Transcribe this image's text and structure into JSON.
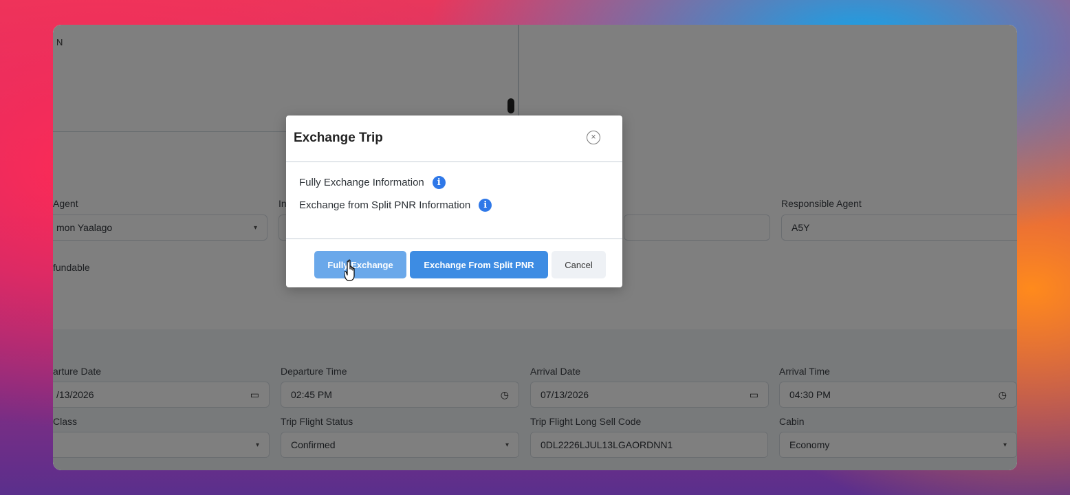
{
  "background_form": {
    "textarea_text": "N",
    "row1": {
      "agent_label": "Agent",
      "agent_value": "mon Yaalago",
      "middle_label": "In",
      "responsible_agent_label": "Responsible Agent",
      "responsible_agent_value": "A5Y"
    },
    "refundable_label": "fundable",
    "segment": {
      "departure_date_label": "arture Date",
      "departure_date_value": "/13/2026",
      "departure_time_label": "Departure Time",
      "departure_time_value": "02:45 PM",
      "arrival_date_label": "Arrival Date",
      "arrival_date_value": "07/13/2026",
      "arrival_time_label": "Arrival Time",
      "arrival_time_value": "04:30 PM",
      "class_label": "Class",
      "class_value": "",
      "trip_flight_status_label": "Trip Flight Status",
      "trip_flight_status_value": "Confirmed",
      "long_sell_code_label": "Trip Flight Long Sell Code",
      "long_sell_code_value": "0DL2226LJUL13LGAORDNN1",
      "cabin_label": "Cabin",
      "cabin_value": "Economy"
    }
  },
  "modal": {
    "title": "Exchange Trip",
    "close_glyph": "×",
    "info_glyph": "i",
    "lines": [
      "Fully Exchange Information",
      "Exchange from Split PNR Information"
    ],
    "buttons": {
      "fully_exchange": "Fully Exchange",
      "exchange_split": "Exchange From Split PNR",
      "cancel": "Cancel"
    }
  },
  "icons": {
    "select_caret": "▾",
    "calendar": "▭",
    "clock": "◷"
  },
  "colors": {
    "primary_button": "#3d8ce3",
    "primary_button_hover": "#6aa8ea",
    "info_icon": "#2f78e8",
    "overlay": "rgba(0,0,0,0.5)"
  }
}
